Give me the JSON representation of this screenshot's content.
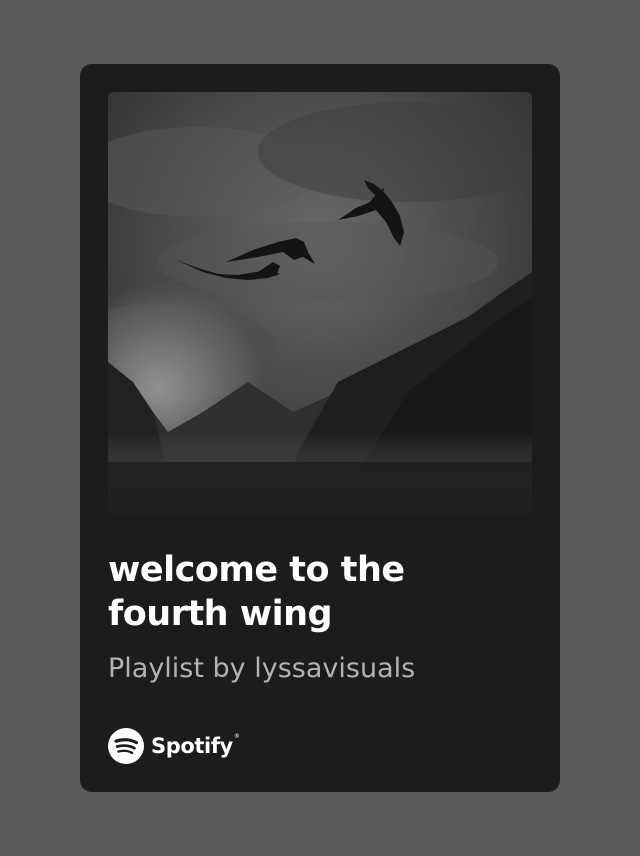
{
  "playlist": {
    "title": "welcome to the fourth wing",
    "subtitle": "Playlist by lyssavisuals",
    "cover_alt": "dragons flying over misty mountains"
  },
  "brand": {
    "name": "Spotify",
    "trademark": "®",
    "icon": "spotify-logo-icon"
  },
  "colors": {
    "page_background": "#595959",
    "card_background": "#1c1c1c",
    "title": "#ffffff",
    "subtitle": "#b3b3b3"
  }
}
